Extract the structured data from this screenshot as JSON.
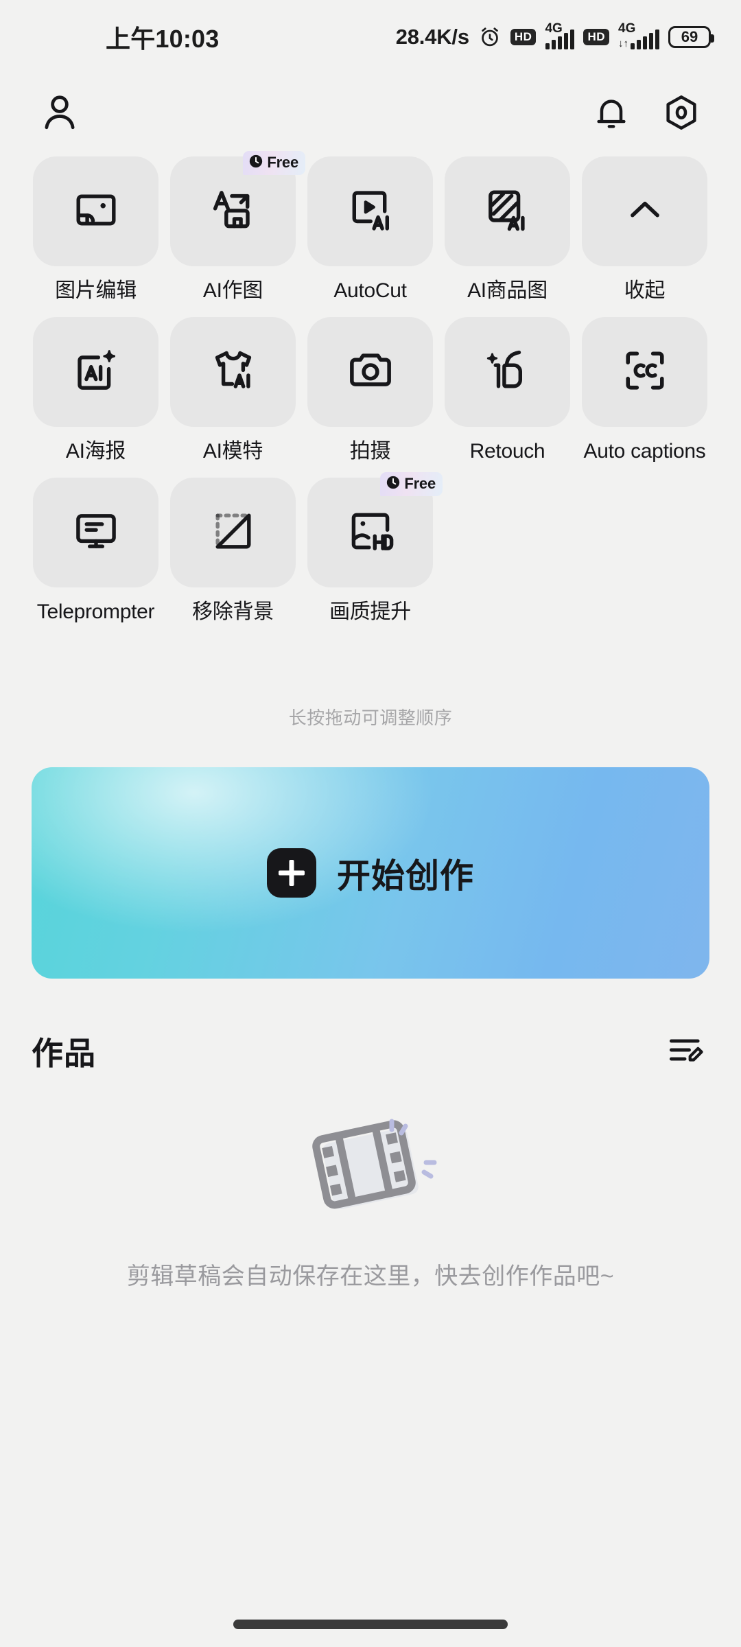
{
  "status_bar": {
    "time": "上午10:03",
    "network_speed": "28.4K/s",
    "alarm_icon": "alarm-clock-icon",
    "sim1": {
      "hd_label": "HD",
      "network_label": "4G"
    },
    "sim2": {
      "hd_label": "HD",
      "network_label": "4G"
    },
    "battery_percent": "69"
  },
  "header": {
    "profile_icon": "person-icon",
    "notification_icon": "bell-icon",
    "settings_icon": "hexagon-gear-icon"
  },
  "tools": {
    "drag_hint": "长按拖动可调整顺序",
    "badge_free_label": "Free",
    "badge_clock_icon": "clock-icon",
    "items": [
      {
        "label": "图片编辑",
        "icon": "image-edit-icon",
        "badge": null
      },
      {
        "label": "AI作图",
        "icon": "ai-text-to-image-icon",
        "badge": "Free"
      },
      {
        "label": "AutoCut",
        "icon": "autocut-ai-icon",
        "badge": null
      },
      {
        "label": "AI商品图",
        "icon": "ai-product-image-icon",
        "badge": null
      },
      {
        "label": "收起",
        "icon": "chevron-up-icon",
        "badge": null
      },
      {
        "label": "AI海报",
        "icon": "ai-poster-icon",
        "badge": null
      },
      {
        "label": "AI模特",
        "icon": "ai-model-shirt-icon",
        "badge": null
      },
      {
        "label": "拍摄",
        "icon": "camera-icon",
        "badge": null
      },
      {
        "label": "Retouch",
        "icon": "retouch-face-icon",
        "badge": null
      },
      {
        "label": "Auto captions",
        "icon": "closed-caption-icon",
        "badge": null
      },
      {
        "label": "Teleprompter",
        "icon": "teleprompter-icon",
        "badge": null
      },
      {
        "label": "移除背景",
        "icon": "remove-background-icon",
        "badge": null
      },
      {
        "label": "画质提升",
        "icon": "hd-enhance-icon",
        "badge": "Free"
      }
    ]
  },
  "cta": {
    "label": "开始创作",
    "plus_icon": "plus-icon",
    "gradient_start": "#57d4da",
    "gradient_end": "#7fb6ed"
  },
  "works": {
    "title": "作品",
    "action_icon": "edit-list-icon",
    "empty_art_icon": "film-strip-icon",
    "empty_text": "剪辑草稿会自动保存在这里，快去创作作品吧~"
  },
  "system": {
    "home_indicator": "home-indicator"
  },
  "colors": {
    "background": "#f2f2f1",
    "tile": "#e6e6e6",
    "text_primary": "#17171a",
    "text_muted": "#9a9a9e"
  }
}
